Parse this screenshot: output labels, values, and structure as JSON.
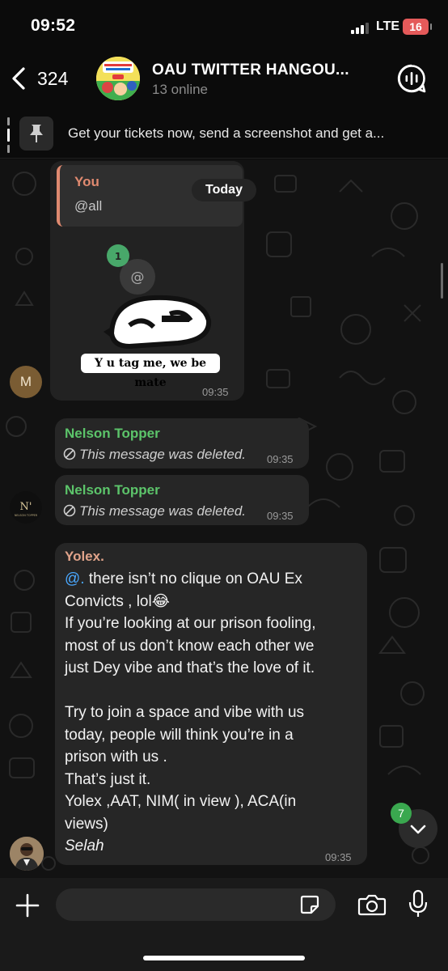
{
  "status": {
    "time": "09:52",
    "network": "LTE",
    "battery": "16"
  },
  "header": {
    "back_count": "324",
    "title": "OAU TWITTER HANGOU...",
    "subtitle": "13 online"
  },
  "pinned": {
    "text": "Get your tickets now, send a screenshot and get a..."
  },
  "date_chip": "Today",
  "messages": [
    {
      "reply_name": "You",
      "reply_text": "@all",
      "sticker_caption": "Y u tag me, we be mate",
      "sticker_badge": "1",
      "sticker_mention": "@",
      "time": "09:35",
      "avatar_initial": "M"
    },
    {
      "sender": "Nelson Topper",
      "text": "This message was deleted.",
      "time": "09:35"
    },
    {
      "sender": "Nelson Topper",
      "text": "This message was deleted.",
      "time": "09:35",
      "avatar_logo": "N'",
      "avatar_logo_caption": "NELSON TOPPER"
    },
    {
      "sender": "Yolex.",
      "mention": "@.",
      "lines": [
        " there isn’t no clique on OAU Ex",
        "Convicts , lol😂",
        "If you’re looking at our prison fooling,",
        "most of us don’t know each other we",
        "just Dey vibe and that’s the love of it.",
        "Try to join a space and vibe with us",
        "today, people will think you’re in a",
        "prison with us .",
        "That’s just it.",
        "Yolex ,AAT, NIM( in view ), ACA(in",
        "views)",
        "Selah"
      ],
      "time": "09:35"
    }
  ],
  "scroll": {
    "unread_count": "7"
  },
  "composer": {
    "placeholder": ""
  },
  "colors": {
    "accent_green": "#5cc46a",
    "reply_accent": "#e08a70",
    "yolex_name": "#e0a38a",
    "badge_green": "#3aa84f",
    "battery_red": "#e45a5a",
    "mention_blue": "#4aa8ff"
  }
}
